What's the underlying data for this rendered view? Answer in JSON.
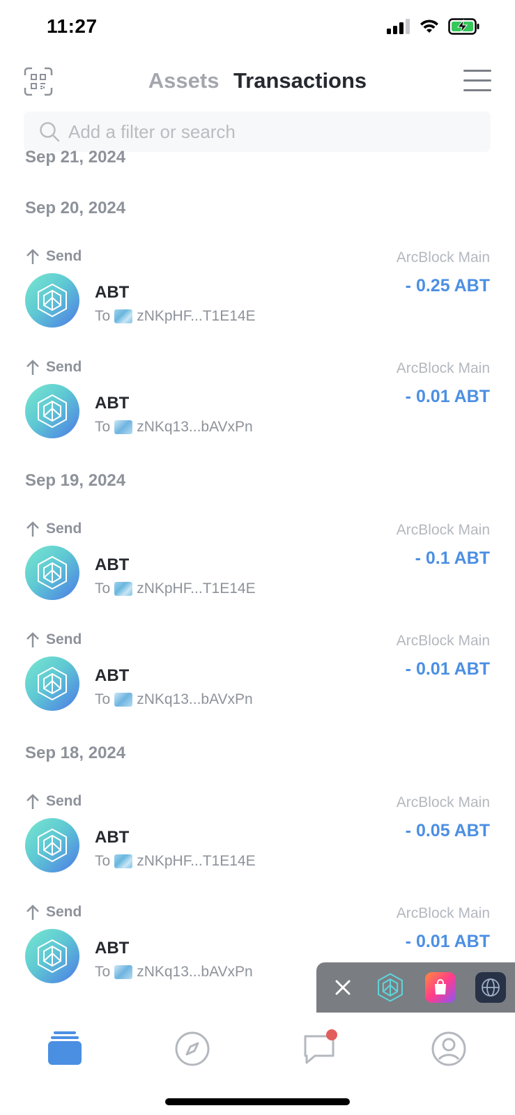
{
  "status_bar": {
    "time": "11:27"
  },
  "header": {
    "tabs": [
      {
        "label": "Assets",
        "active": false
      },
      {
        "label": "Transactions",
        "active": true
      }
    ]
  },
  "search": {
    "placeholder": "Add a filter or search"
  },
  "dates": [
    "Sep 21, 2024",
    "Sep 20, 2024",
    "Sep 19, 2024",
    "Sep 18, 2024"
  ],
  "transactions": [
    {
      "type": "Send",
      "chain": "ArcBlock Main",
      "token": "ABT",
      "to_prefix": "To",
      "address": "zNKpHF...T1E14E",
      "amount": "- 0.25 ABT"
    },
    {
      "type": "Send",
      "chain": "ArcBlock Main",
      "token": "ABT",
      "to_prefix": "To",
      "address": "zNKq13...bAVxPn",
      "amount": "- 0.01 ABT"
    },
    {
      "type": "Send",
      "chain": "ArcBlock Main",
      "token": "ABT",
      "to_prefix": "To",
      "address": "zNKpHF...T1E14E",
      "amount": "- 0.1 ABT"
    },
    {
      "type": "Send",
      "chain": "ArcBlock Main",
      "token": "ABT",
      "to_prefix": "To",
      "address": "zNKq13...bAVxPn",
      "amount": "- 0.01 ABT"
    },
    {
      "type": "Send",
      "chain": "ArcBlock Main",
      "token": "ABT",
      "to_prefix": "To",
      "address": "zNKpHF...T1E14E",
      "amount": "- 0.05 ABT"
    },
    {
      "type": "Send",
      "chain": "ArcBlock Main",
      "token": "ABT",
      "to_prefix": "To",
      "address": "zNKq13...bAVxPn",
      "amount": "- 0.01 ABT"
    }
  ],
  "colors": {
    "accent": "#4b8fe3",
    "heading": "#25292f",
    "muted": "#8d929a",
    "notification": "#e35d5d"
  },
  "tabbar": {
    "items": [
      {
        "icon": "wallet-icon",
        "active": true
      },
      {
        "icon": "compass-icon",
        "active": false
      },
      {
        "icon": "chat-icon",
        "active": false,
        "badge": true
      },
      {
        "icon": "profile-icon",
        "active": false
      }
    ]
  }
}
